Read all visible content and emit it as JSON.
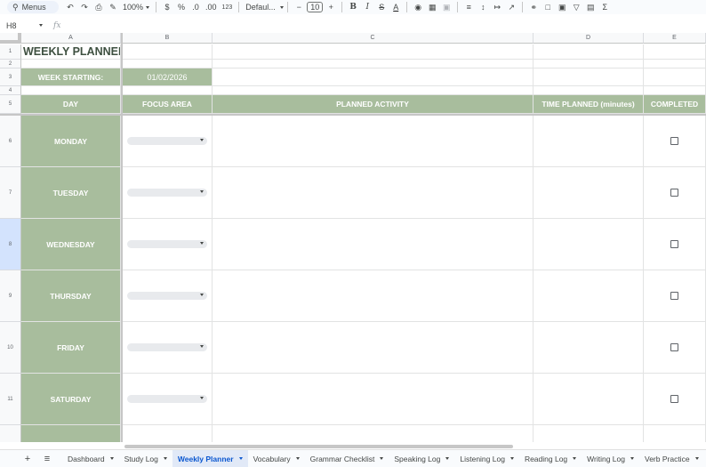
{
  "toolbar": {
    "search_label": "Menus",
    "zoom": "100%",
    "currency": "$",
    "percent": "%",
    "decimal_decrease": ".0",
    "decimal_increase": ".00",
    "number_format": "123",
    "font": "Defaul...",
    "font_size": "10",
    "bold": "B",
    "italic": "I",
    "strike": "S",
    "text_color": "A",
    "sum": "Σ"
  },
  "formula_bar": {
    "name_box": "H8",
    "fx": "fx"
  },
  "columns": [
    {
      "id": "A"
    },
    {
      "id": "B"
    },
    {
      "id": "C"
    },
    {
      "id": "D"
    },
    {
      "id": "E"
    }
  ],
  "row_numbers": [
    "1",
    "2",
    "3",
    "4",
    "5",
    "6",
    "7",
    "8",
    "9",
    "10",
    "11"
  ],
  "selected_row": "8",
  "sheet": {
    "title": "WEEKLY PLANNER",
    "week_label": "WEEK STARTING:",
    "week_value": "01/02/2026",
    "headers": {
      "day": "DAY",
      "focus": "FOCUS AREA",
      "activity": "PLANNED ACTIVITY",
      "time": "TIME PLANNED (minutes)",
      "completed": "COMPLETED"
    },
    "days": [
      "MONDAY",
      "TUESDAY",
      "WEDNESDAY",
      "THURSDAY",
      "FRIDAY",
      "SATURDAY"
    ]
  },
  "tabs": [
    {
      "label": "Dashboard",
      "active": false
    },
    {
      "label": "Study Log",
      "active": false
    },
    {
      "label": "Weekly Planner",
      "active": true
    },
    {
      "label": "Vocabulary",
      "active": false
    },
    {
      "label": "Grammar Checklist",
      "active": false
    },
    {
      "label": "Speaking Log",
      "active": false
    },
    {
      "label": "Listening Log",
      "active": false
    },
    {
      "label": "Reading Log",
      "active": false
    },
    {
      "label": "Writing Log",
      "active": false
    },
    {
      "label": "Verb Practice",
      "active": false
    }
  ],
  "colors": {
    "accent_green": "#a8bd9d",
    "title_text": "#3e5040",
    "active_tab": "#0b57d0",
    "selected_row_header": "#d3e3fd"
  },
  "icons": {
    "undo": "undo-icon",
    "redo": "redo-icon",
    "print": "print-icon",
    "paint_format": "paint-format-icon",
    "fill": "fill-color-icon",
    "borders": "borders-icon",
    "merge": "merge-cells-icon",
    "link": "link-icon",
    "comment": "comment-icon",
    "image": "insert-image-icon",
    "filter": "filter-icon"
  }
}
